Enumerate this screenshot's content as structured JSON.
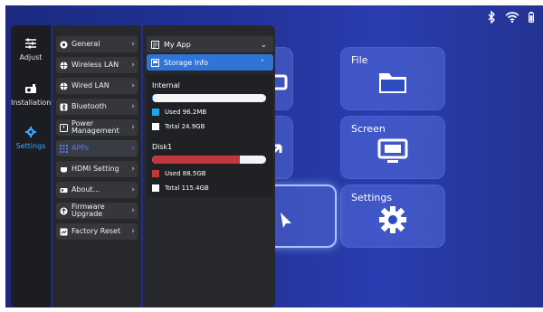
{
  "status_icons": [
    "bluetooth-icon",
    "wifi-icon",
    "battery-icon"
  ],
  "tiles": {
    "file": "File",
    "screen": "Screen",
    "settings": "Settings"
  },
  "rail": [
    {
      "label": "Adjust",
      "icon": "sliders-icon"
    },
    {
      "label": "Installation",
      "icon": "projector-icon"
    },
    {
      "label": "Settings",
      "icon": "gear-icon",
      "active": true
    }
  ],
  "menu": [
    {
      "label": "General",
      "icon": "general-icon"
    },
    {
      "label": "Wireless LAN",
      "icon": "globe-icon"
    },
    {
      "label": "Wired LAN",
      "icon": "globe-icon"
    },
    {
      "label": "Bluetooth",
      "icon": "bluetooth-icon"
    },
    {
      "label": "Power Management",
      "icon": "power-icon"
    },
    {
      "label": "APPs",
      "icon": "apps-grid-icon",
      "active": true
    },
    {
      "label": "HDMI Setting",
      "icon": "hdmi-icon"
    },
    {
      "label": "About...",
      "icon": "about-icon"
    },
    {
      "label": "Firmware Upgrade",
      "icon": "upgrade-icon"
    },
    {
      "label": "Factory Reset",
      "icon": "reset-icon"
    }
  ],
  "apps": {
    "my_app": "My App",
    "storage_info": "Storage Info",
    "internal": {
      "title": "Internal",
      "used_label": "Used 96.2MB",
      "total_label": "Total 24.9GB",
      "used_fraction": 0.004,
      "used_color": "#1ea7e8"
    },
    "disk1": {
      "title": "Disk1",
      "used_label": "Used 88.5GB",
      "total_label": "Total 115.4GB",
      "used_fraction": 0.77,
      "used_color": "#c0383a"
    }
  },
  "colors": {
    "accent": "#2f74d6",
    "active_text": "#4a7dff"
  }
}
